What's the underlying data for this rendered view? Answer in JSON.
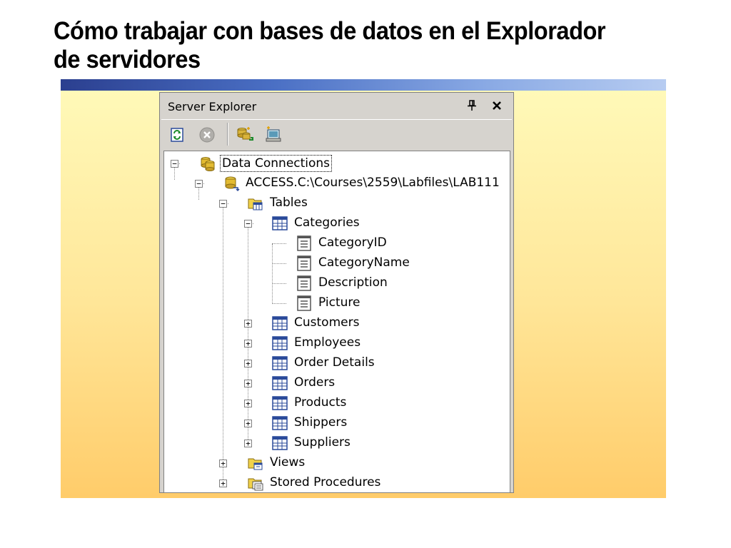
{
  "slide": {
    "title_line1": "Cómo trabajar con bases de datos en el Explorador",
    "title_line2": "de servidores"
  },
  "panel": {
    "title": "Server Explorer",
    "pin_icon": "pin-icon",
    "close_icon": "close-icon"
  },
  "toolbar": {
    "buttons": [
      "refresh-icon",
      "stop-icon",
      "connect-to-database-icon",
      "connect-to-server-icon"
    ]
  },
  "tree": {
    "root": "Data Connections",
    "connection": "ACCESS.C:\\Courses\\2559\\Labfiles\\LAB111",
    "tables_folder": "Tables",
    "expanded_table": "Categories",
    "columns": [
      "CategoryID",
      "CategoryName",
      "Description",
      "Picture"
    ],
    "tables": [
      "Customers",
      "Employees",
      "Order Details",
      "Orders",
      "Products",
      "Shippers",
      "Suppliers"
    ],
    "views_folder": "Views",
    "procs_folder": "Stored Procedures"
  },
  "colors": {
    "title_bar_dark": "#2b3f8f",
    "title_bar_light": "#b7ccf1",
    "background_top": "#fff9b8",
    "background_bottom": "#ffcc6a",
    "panel_face": "#d6d3ce"
  }
}
